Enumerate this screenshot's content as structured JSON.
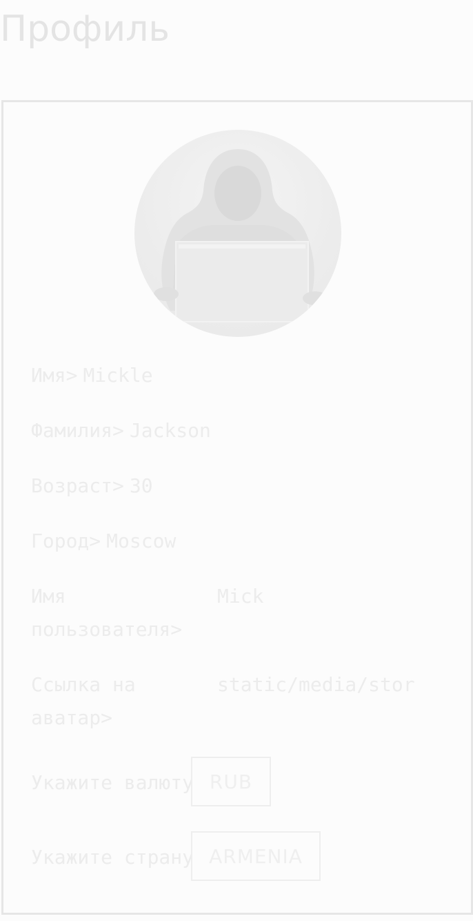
{
  "page": {
    "title": "Профиль"
  },
  "profile": {
    "avatar_icon": "hacker-avatar",
    "first_name_label": "Имя>",
    "first_name": "Mickle",
    "last_name_label": "Фамилия>",
    "last_name": "Jackson",
    "age_label": "Возраст>",
    "age": "30",
    "city_label": "Город>",
    "city": "Moscow",
    "username_label": "Имя пользователя>",
    "username": "Mick",
    "avatar_link_label": "Ссылка на аватар>",
    "avatar_link": "static/media/stor",
    "currency_label": "Укажите валюту>",
    "currency": "RUB",
    "country_label": "Укажите страну>",
    "country": "ARMENIA"
  },
  "colors": {
    "background": "#fcfcfc",
    "text": "#ececec",
    "border": "#e6e6e6",
    "artifact": "#ff1a00"
  }
}
